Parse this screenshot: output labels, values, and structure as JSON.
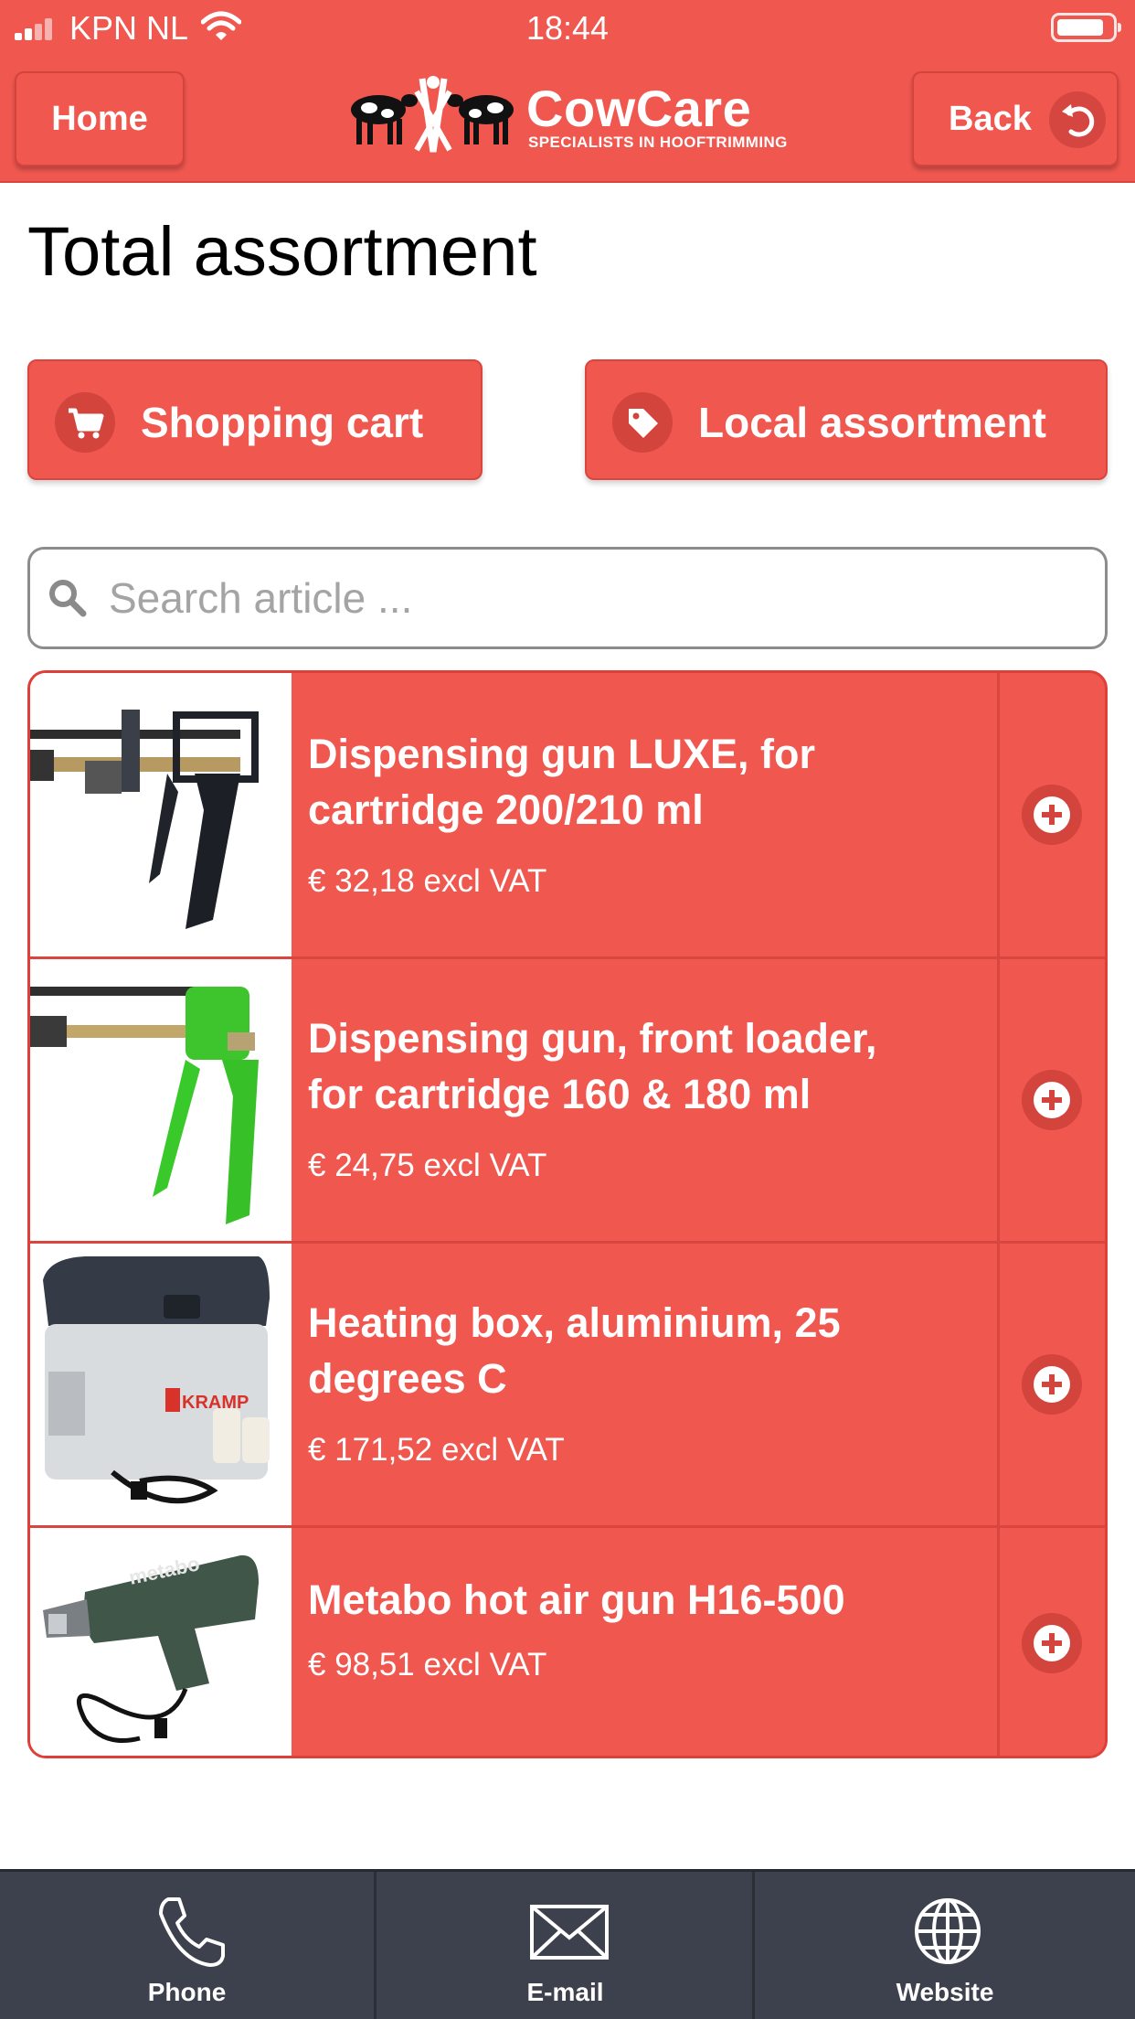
{
  "status_bar": {
    "carrier": "KPN NL",
    "time": "18:44"
  },
  "header": {
    "home_label": "Home",
    "back_label": "Back",
    "logo_brand": "CowCare",
    "logo_tagline": "SPECIALISTS IN HOOFTRIMMING",
    "accent_color": "#ef574f"
  },
  "page_title": "Total assortment",
  "actions": {
    "cart_label": "Shopping cart",
    "local_label": "Local assortment"
  },
  "search": {
    "placeholder": "Search article ...",
    "value": ""
  },
  "products": [
    {
      "name": "Dispensing gun LUXE, for cartridge 200/210 ml",
      "price": "€ 32,18 excl VAT",
      "image": "black-dispensing-gun"
    },
    {
      "name": "Dispensing gun, front loader, for cartridge 160 & 180 ml",
      "price": "€ 24,75 excl VAT",
      "image": "green-dispensing-gun"
    },
    {
      "name": "Heating box, aluminium, 25 degrees C",
      "price": "€ 171,52 excl VAT",
      "image": "kramp-heating-box"
    },
    {
      "name": "Metabo hot air gun H16-500",
      "price": "€ 98,51 excl VAT",
      "image": "metabo-hot-air-gun"
    }
  ],
  "bottom_nav": [
    {
      "label": "Phone",
      "icon": "phone-icon"
    },
    {
      "label": "E-mail",
      "icon": "envelope-icon"
    },
    {
      "label": "Website",
      "icon": "globe-icon"
    }
  ],
  "image_text": {
    "heating_box_brand": "KRAMP",
    "hot_air_gun_brand": "metabo"
  },
  "bottom_bar_color": "#3d414d"
}
